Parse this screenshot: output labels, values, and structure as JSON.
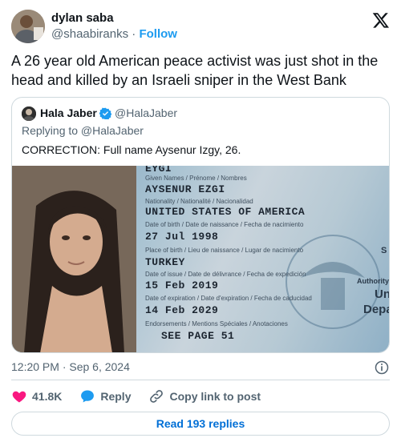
{
  "author": {
    "name": "dylan saba",
    "handle": "@shaabiranks",
    "separator": "·",
    "follow_label": "Follow"
  },
  "tweet_text": "A 26 year old American peace activist was just shot in the head and killed by an Israeli sniper in the West Bank",
  "quote": {
    "name": "Hala Jaber",
    "handle": "@HalaJaber",
    "replying_to": "Replying to @HalaJaber",
    "text": "CORRECTION: Full name Aysenur Izgy, 26.",
    "passport": {
      "surname": "EYGI",
      "given_names_label": "Given Names / Prénome / Nombres",
      "given_names": "AYSENUR EZGI",
      "nationality_label": "Nationality / Nationalité / Nacionalidad",
      "nationality": "UNITED STATES OF AMERICA",
      "dob_label": "Date of birth / Date de naissance / Fecha de nacimiento",
      "dob": "27 Jul 1998",
      "pob_label": "Place of birth / Lieu de naissance / Lugar de nacimiento",
      "pob": "TURKEY",
      "issue_label": "Date of issue / Date de délivrance / Fecha de expedición",
      "issue": "15 Feb 2019",
      "expiry_label": "Date of expiration / Date d'expiration / Fecha de caducidad",
      "expiry": "14 Feb 2029",
      "endorse_label": "Endorsements / Mentions Spéciales / Anotaciones",
      "endorse": "SEE PAGE 51",
      "authority_label": "Authority",
      "authority_1": "Un",
      "authority_2": "Depar",
      "edge_letter": "S"
    }
  },
  "timestamp": "12:20 PM · Sep 6, 2024",
  "actions": {
    "likes": "41.8K",
    "reply_label": "Reply",
    "copy_label": "Copy link to post"
  },
  "read_replies": "Read 193 replies",
  "colors": {
    "accent": "#1d9bf0",
    "like": "#f91880",
    "link_blue": "#006fd6",
    "muted": "#536471"
  }
}
